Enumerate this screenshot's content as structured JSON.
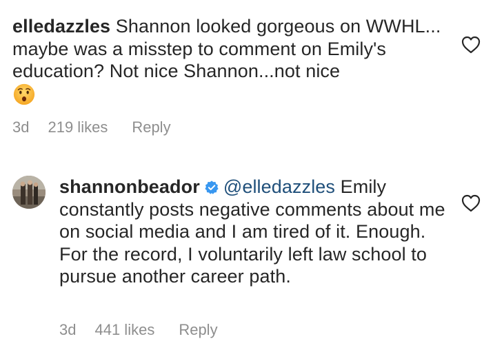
{
  "comments": [
    {
      "username": "elledazzles",
      "text": "Shannon looked gorgeous on WWHL... maybe was a misstep to comment on Emily's education? Not nice Shannon...not nice",
      "emoji": "hushed-face-emoji",
      "time": "3d",
      "likes": "219 likes",
      "reply": "Reply"
    },
    {
      "username": "shannonbeador",
      "verified": true,
      "mention": "@elledazzles",
      "text": "Emily constantly posts negative comments about me on social media and I am tired of it. Enough. For the record, I voluntarily left law school to pursue another career path.",
      "time": "3d",
      "likes": "441 likes",
      "reply": "Reply"
    }
  ],
  "colors": {
    "text": "#262626",
    "meta": "#8e8e8e",
    "mention": "#1f4f7a",
    "verified": "#3897f0"
  },
  "icons": [
    "heart-outline-icon",
    "verified-badge-icon",
    "avatar"
  ]
}
